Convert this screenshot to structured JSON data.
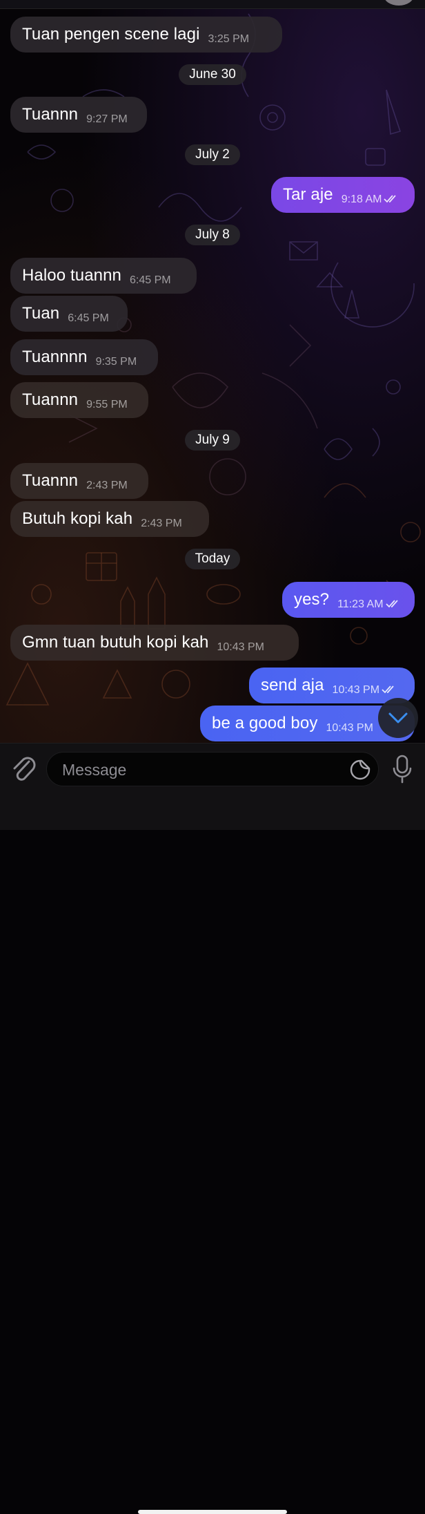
{
  "messages": [
    {
      "type": "in",
      "text": "Tuan pengen scene lagi",
      "time": "3:25 PM"
    },
    {
      "type": "date",
      "text": "June 30"
    },
    {
      "type": "in",
      "text": "Tuannn",
      "time": "9:27 PM"
    },
    {
      "type": "date",
      "text": "July 2"
    },
    {
      "type": "out",
      "text": "Tar aje",
      "time": "9:18 AM"
    },
    {
      "type": "date",
      "text": "July 8"
    },
    {
      "type": "in",
      "text": "Haloo tuannn",
      "time": "6:45 PM"
    },
    {
      "type": "in",
      "text": "Tuan",
      "time": "6:45 PM"
    },
    {
      "type": "in",
      "text": "Tuannnn",
      "time": "9:35 PM"
    },
    {
      "type": "in",
      "text": "Tuannn",
      "time": "9:55 PM"
    },
    {
      "type": "date",
      "text": "July 9"
    },
    {
      "type": "in",
      "text": "Tuannn",
      "time": "2:43 PM"
    },
    {
      "type": "in",
      "text": "Butuh kopi kah",
      "time": "2:43 PM"
    },
    {
      "type": "date",
      "text": "Today"
    },
    {
      "type": "out",
      "text": "yes?",
      "time": "11:23 AM"
    },
    {
      "type": "in",
      "text": "Gmn tuan butuh kopi kah",
      "time": "10:43 PM"
    },
    {
      "type": "out",
      "text": "send aja",
      "time": "10:43 PM"
    },
    {
      "type": "out",
      "text": "be a good boy",
      "time": "10:43 PM"
    }
  ],
  "composer": {
    "placeholder": "Message",
    "attach_icon": "paperclip-icon",
    "sticker_icon": "sticker-icon",
    "mic_icon": "microphone-icon"
  },
  "scroll_down_icon": "chevron-down-icon",
  "colors": {
    "incoming_bubble": "#2c282e",
    "outgoing_purple": "#8046e4",
    "outgoing_blue": "#4e66f1",
    "date_pill": "#28262a",
    "background": "#050406"
  }
}
